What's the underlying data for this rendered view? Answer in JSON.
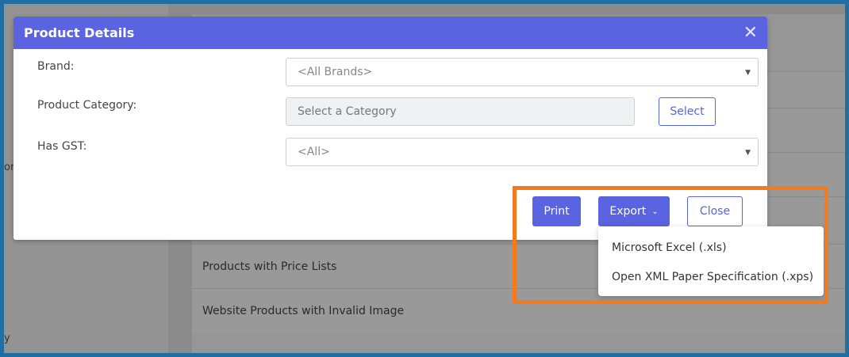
{
  "background": {
    "rows": [
      "Products with Price Lists",
      "Website Products with Invalid Image"
    ],
    "left_edge_fragments": [
      "or",
      "y"
    ]
  },
  "modal": {
    "title": "Product Details",
    "close_icon": "close-icon",
    "fields": {
      "brand": {
        "label": "Brand:",
        "value": "<All Brands>"
      },
      "category": {
        "label": "Product Category:",
        "placeholder": "Select a Category",
        "select_label": "Select"
      },
      "gst": {
        "label": "Has GST:",
        "value": "<All>"
      }
    },
    "buttons": {
      "print": "Print",
      "export": "Export",
      "close": "Close"
    }
  },
  "export_menu": {
    "items": [
      "Microsoft Excel (.xls)",
      "Open XML Paper Specification (.xps)"
    ]
  },
  "colors": {
    "accent": "#5a63e0",
    "highlight": "#f47a1f",
    "frame": "#1f6fa3"
  }
}
